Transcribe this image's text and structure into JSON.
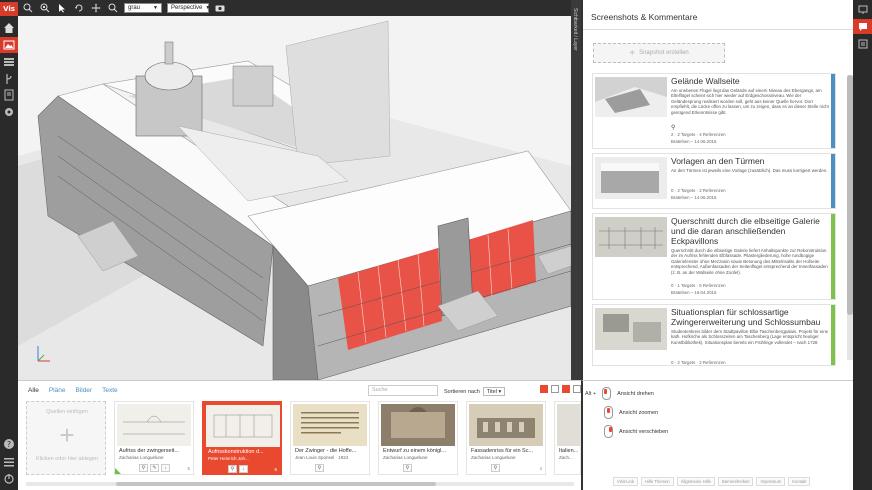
{
  "app": {
    "logo": "Vis"
  },
  "toolbar": {
    "color_select": "grau",
    "camera_select": "Perspective"
  },
  "viewport": {
    "side_label": "Sichtbarkeit / Layer"
  },
  "panel": {
    "title": "Screenshots & Kommentare",
    "snapshot_button": "Snapshot erstellen",
    "cards": [
      {
        "title": "Gelände Wallseite",
        "text": "Am unebenen Flügel liegt das Gelände auf einem Niveau des Ebergangs, am Eltelflügel scheint sich hier wieder auf Erdgeschossniveau. Wie der Geländesprung realisiert worden soll, geht aus keiner Quelle hervor. Dort empfiehlt, die Lücke offen zu lassen, um zu zeigen, dass es an dieser Stelle nicht genügend Erkenntnisse gibt.",
        "meta1": "2 · 2 Targets · 4 Referenzen",
        "meta2": "Bratelsen – 14.06.2016",
        "bar_color": "#4a90c2"
      },
      {
        "title": "Vorlagen an den Türmen",
        "text": "An den Türmen ist jeweils eine Vorlage (zusätzlich). Das muss korrigiert werden.",
        "meta1": "0 · 2 Targets · 2 Referenzen",
        "meta2": "Bratelsen – 14.06.2016",
        "bar_color": "#4a90c2"
      },
      {
        "title": "Querschnitt durch die elbseitige Galerie und die daran anschließenden Eckpavillons",
        "text": "Querschnitt durch die elbseitige Galerie liefert Anhaltspunkte zur Rekonstruktion der im Aufriss fehlenden Elbfassade. Pilastergliederung, hohe rundbogige Galeriefenster ohne Mezzanin sowie Betonung des Mittelrisalits der Hofseite entsprechend. Außenfassaden der Seitenflügel entsprechend der Innenfassaden (z. B. an der Wallseite ohne Zoofel).",
        "meta1": "0 · 1 Targets · 5 Referenzen",
        "meta2": "Bratelsen – 16.04.2016",
        "bar_color": "#7ec24a"
      },
      {
        "title": "Situationsplan für schlossartige Zwingererweiterung und Schlossumbau",
        "text": "Studentenkreis bilder dem Stadtpavillon Elbe Taschenbergpalais. Projekt für eine kath. Hofkirche als Schlosszeiten am Taschenberg (Lage entspricht heutiger Kunstbibliothek). Situationsplan bereits ein Frühlinge vollendet – nach 1728",
        "meta1": "0 · 2 Targets · 2 Referenzen",
        "meta2": "",
        "bar_color": "#7ec24a"
      }
    ]
  },
  "gallery": {
    "tabs": [
      "Alle",
      "Pläne",
      "Bilder",
      "Texte"
    ],
    "search_placeholder": "Suche",
    "sort_label": "Sortieren nach",
    "sort_value": "Titel",
    "upload_title": "Quellen einfügen",
    "upload_hint": "Klicken oder hier ablegen",
    "items": [
      {
        "title": "Aufriss der zwingerseit...",
        "sub": "Zacharias Longuelune",
        "count": "5",
        "selected": false
      },
      {
        "title": "Aufrisskonstruktion d...",
        "sub": "Peter Heinrich Joh...",
        "count": "6",
        "selected": true
      },
      {
        "title": "Der Zwinger - die Hoffe...",
        "sub": "Jean Louis Sponsel · 1924",
        "count": "",
        "selected": false
      },
      {
        "title": "Entwurf zu einem königl...",
        "sub": "Zacharias Longuelune",
        "count": "",
        "selected": false
      },
      {
        "title": "Fassadenriss für ein Sc...",
        "sub": "Zacharias Longuelune",
        "count": "4",
        "selected": false
      },
      {
        "title": "Italien...",
        "sub": "Zach...",
        "count": "",
        "selected": false
      }
    ]
  },
  "controls": {
    "key_prefix": "Alt +",
    "rotate": "Ansicht drehen",
    "zoom": "Ansicht zoomen",
    "pan": "Ansicht verschieben",
    "footer_links": [
      "Visit-Link",
      "Hilfe Themen",
      "Allgemeine Hilfe",
      "Barrierefreiheit",
      "Impressum",
      "Kontakt"
    ]
  },
  "colors": {
    "accent": "#d93b2b",
    "link": "#4a90c2",
    "tag_green": "#7ec24a"
  }
}
